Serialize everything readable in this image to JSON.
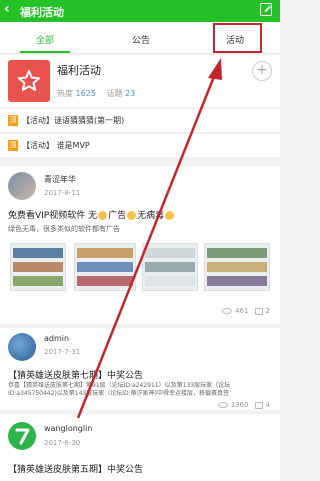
{
  "topbar": {
    "title": "福利活动"
  },
  "tabs": [
    {
      "label": "全部",
      "active": true
    },
    {
      "label": "公告",
      "active": false
    },
    {
      "label": "活动",
      "active": false
    }
  ],
  "group": {
    "name": "福利活动",
    "popularity_label": "热度",
    "popularity": "1625",
    "topics_label": "话题",
    "topics": "23",
    "add_symbol": "+"
  },
  "notices": [
    {
      "badge": "顶",
      "text": "【活动】谜语猜猜猜(第一期)"
    },
    {
      "badge": "顶",
      "text": "【活动】 谁是MVP"
    }
  ],
  "posts": [
    {
      "user": "青涩年华",
      "date": "2017-8-11",
      "title_a": "免费看VIP视频软件 无",
      "title_b": "广告",
      "title_c": "无病毒",
      "body": "绿色无毒，很多类似的软件都有广告",
      "views": "461",
      "comments": "2"
    },
    {
      "user": "admin",
      "date": "2017-7-31",
      "title": "【猜英雄送皮肤第七期】中奖公告",
      "body": "恭喜【猜英雄送皮肤第七期】第91层（论坛ID:a242911）以及第133层玩家（论坛ID:a345750442)以及第143层玩家（论坛ID:蒂汐家神)中得幸运楼层，移载赛真签",
      "views": "1360",
      "comments": "4"
    },
    {
      "user": "wanglonglin",
      "date": "2017-6-30",
      "title": "【猜英雄送皮肤第五期】中奖公告"
    }
  ],
  "colors": {
    "brand": "#25c227",
    "annotation": "#c1272d",
    "badge": "#f0a020"
  }
}
